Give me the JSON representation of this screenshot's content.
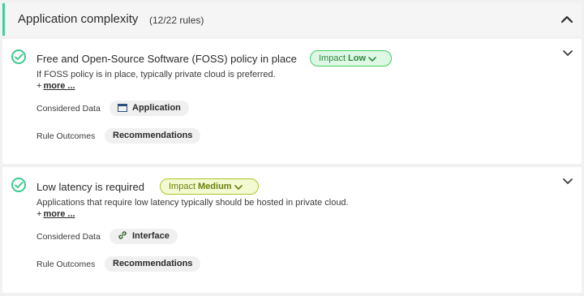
{
  "section": {
    "title": "Application complexity",
    "count": "(12/22 rules)"
  },
  "rules": [
    {
      "title": "Free and Open-Source Software (FOSS) policy in place",
      "impact_label": "Impact",
      "impact_level": "Low",
      "description": "If FOSS policy is in place, typically private cloud is preferred.",
      "more_prefix": "+",
      "more_label": "more ...",
      "considered_label": "Considered Data",
      "considered_value": "Application",
      "considered_icon": "window-icon",
      "outcomes_label": "Rule Outcomes",
      "outcomes_value": "Recommendations"
    },
    {
      "title": "Low latency is required",
      "impact_label": "Impact",
      "impact_level": "Medium",
      "description": "Applications that require low latency typically should be hosted in private cloud.",
      "more_prefix": "+",
      "more_label": "more ...",
      "considered_label": "Considered Data",
      "considered_value": "Interface",
      "considered_icon": "link-icon",
      "outcomes_label": "Rule Outcomes",
      "outcomes_value": "Recommendations"
    }
  ],
  "colors": {
    "accent": "#3fcf9f",
    "check": "#3fc98f",
    "impact_low": "#3fcf5f",
    "impact_medium": "#a8c82a"
  }
}
